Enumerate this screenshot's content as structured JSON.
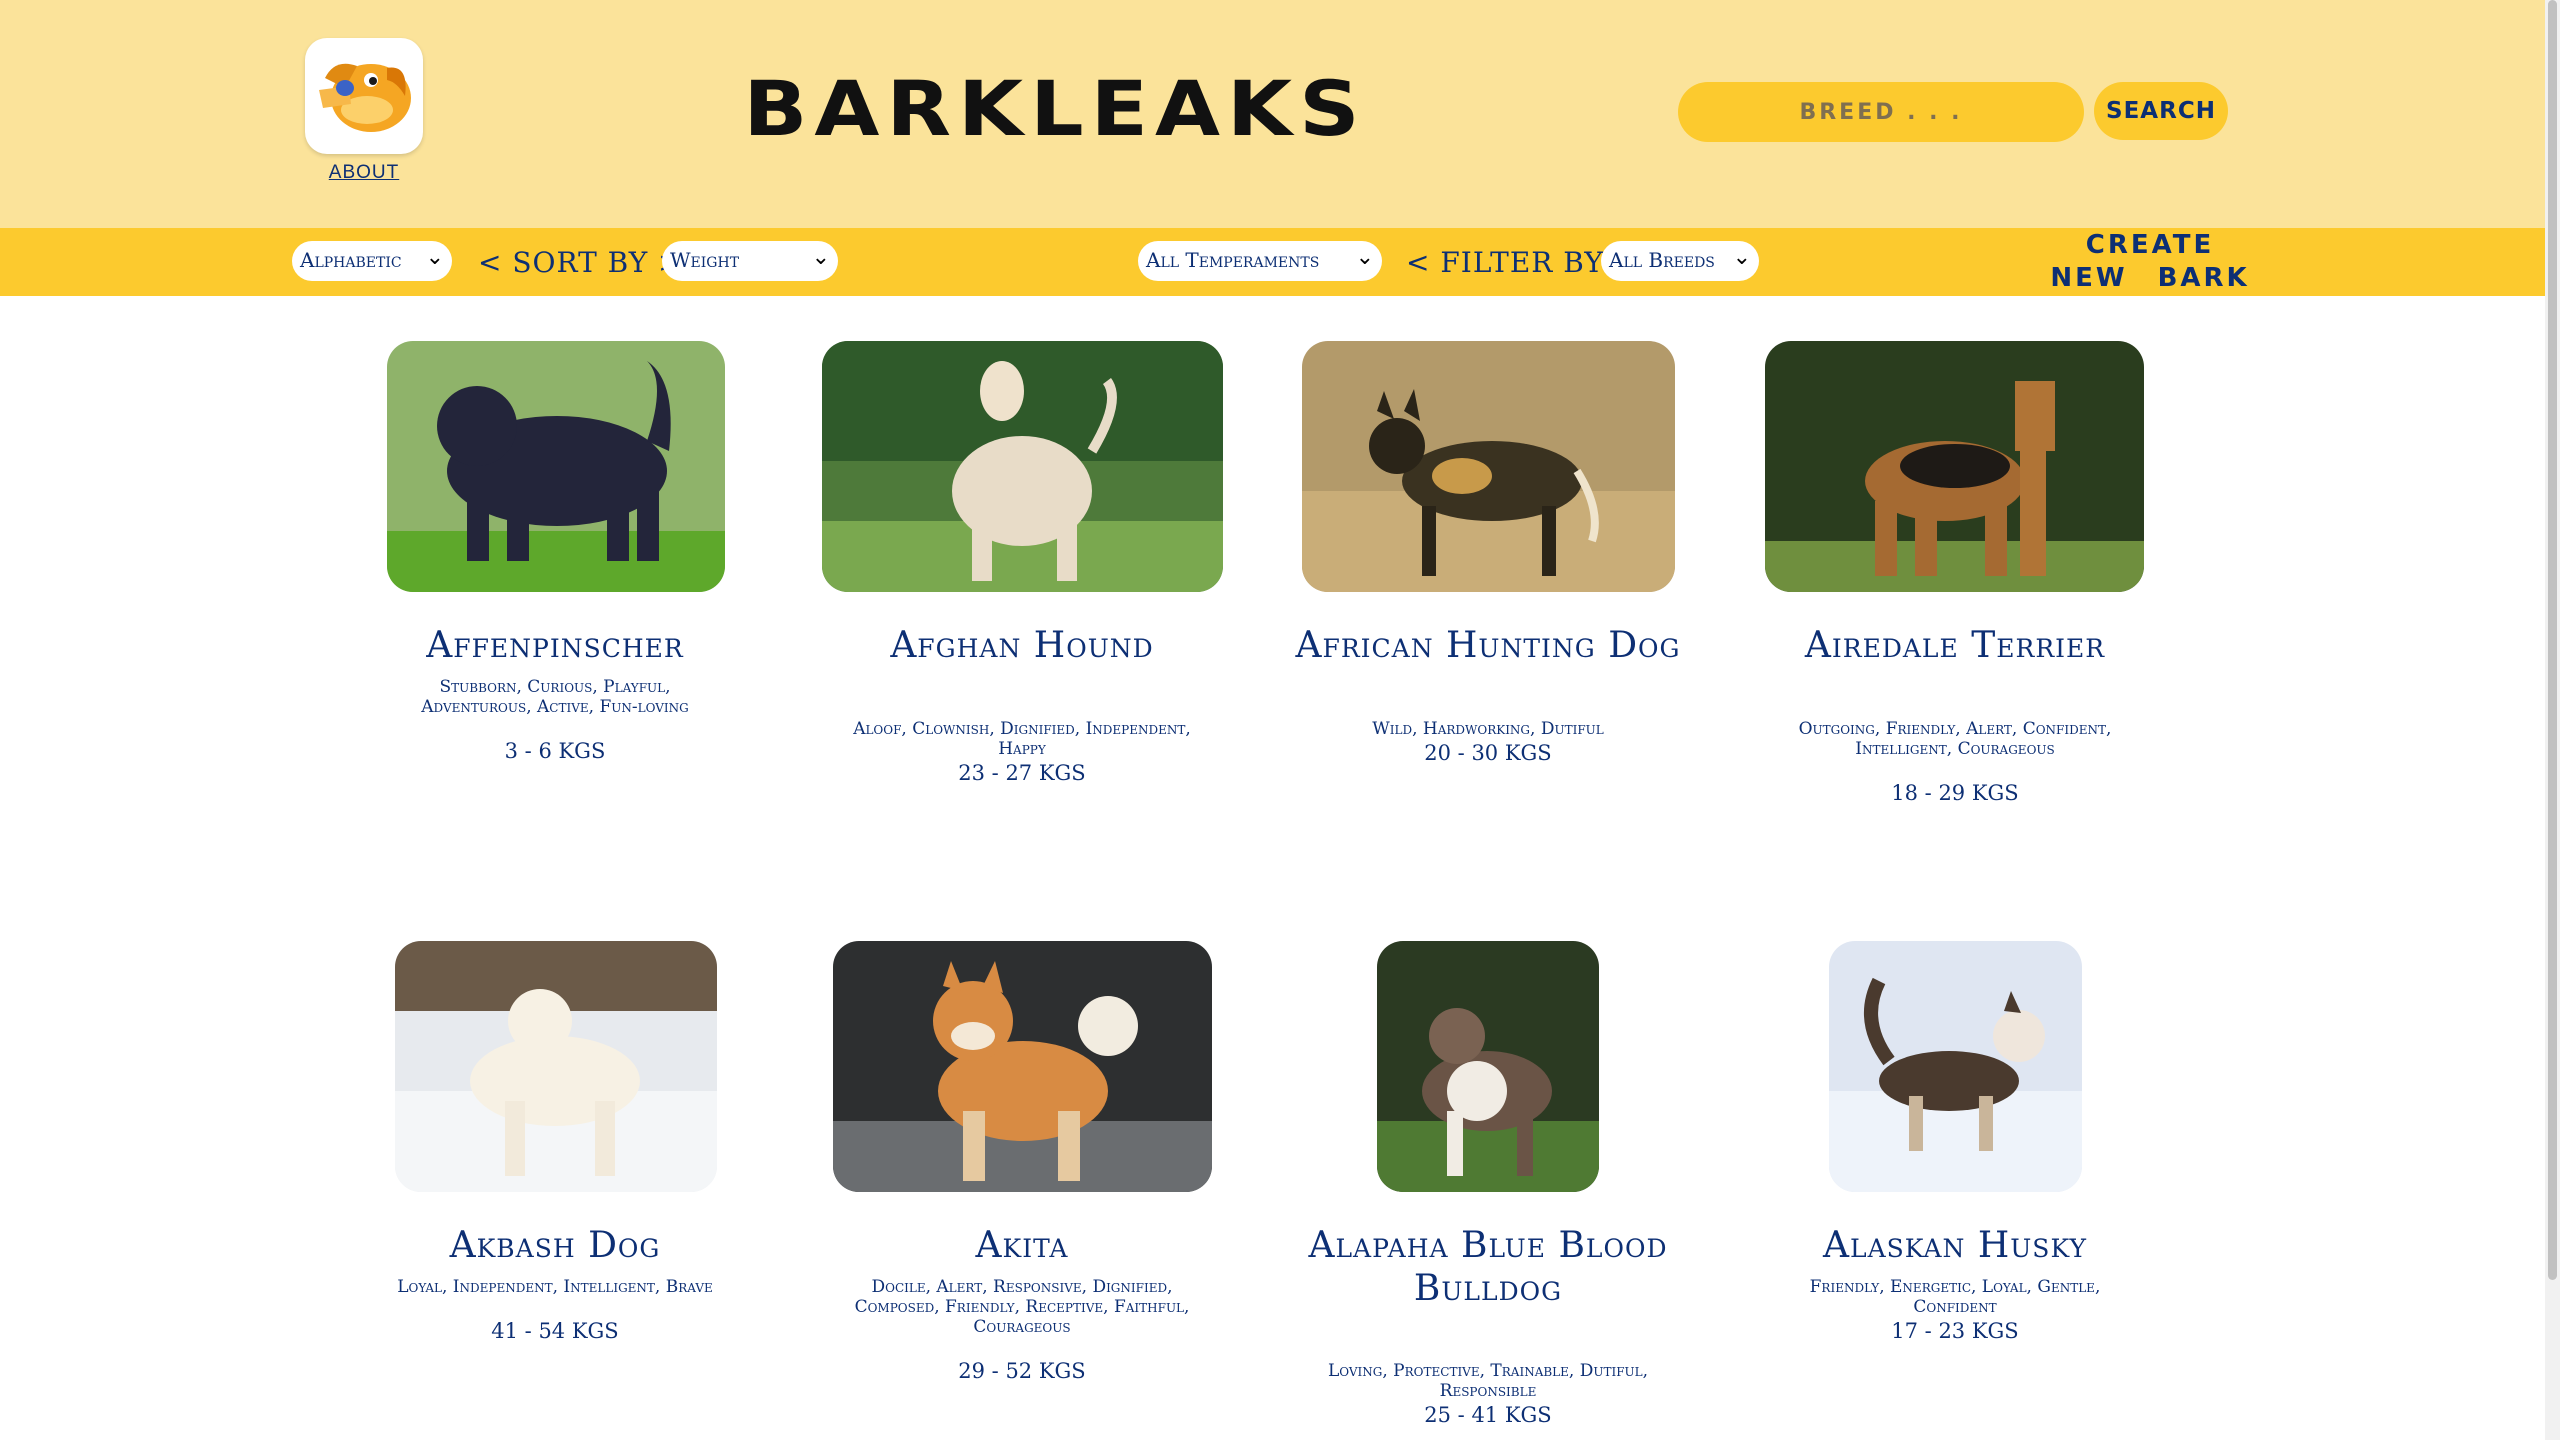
{
  "header": {
    "title": "BARKLEAKS",
    "about_label": "ABOUT",
    "search": {
      "placeholder": "BREED . . .",
      "button_label": "SEARCH"
    }
  },
  "toolbar": {
    "order_select": "Alphabetic",
    "sort_label": "< SORT BY >",
    "sort_select": "Weight",
    "temperament_select": "All Temperaments",
    "filter_label": "< FILTER BY >",
    "breed_select": "All Breeds",
    "create_line1": "CREATE",
    "create_line2": "NEW BARK"
  },
  "colors": {
    "header_bg": "#fbe39a",
    "accent_yellow": "#fcca2e",
    "text_navy": "#0d2f74"
  },
  "cards": [
    {
      "name": "Affenpinscher",
      "temperaments": "Stubborn, Curious, Playful, Adventurous, Active, Fun-loving",
      "weight": "3 - 6 KGS"
    },
    {
      "name": "Afghan Hound",
      "temperaments": "Aloof, Clownish, Dignified, Independent, Happy",
      "weight": "23 - 27 KGS"
    },
    {
      "name": "African Hunting Dog",
      "temperaments": "Wild, Hardworking, Dutiful",
      "weight": "20 - 30 KGS"
    },
    {
      "name": "Airedale Terrier",
      "temperaments": "Outgoing, Friendly, Alert, Confident, Intelligent, Courageous",
      "weight": "18 - 29 KGS"
    },
    {
      "name": "Akbash Dog",
      "temperaments": "Loyal, Independent, Intelligent, Brave",
      "weight": "41 - 54 KGS"
    },
    {
      "name": "Akita",
      "temperaments": "Docile, Alert, Responsive, Dignified, Composed, Friendly, Receptive, Faithful, Courageous",
      "weight": "29 - 52 KGS"
    },
    {
      "name": "Alapaha Blue Blood Bulldog",
      "temperaments": "Loving, Protective, Trainable, Dutiful, Responsible",
      "weight": "25 - 41 KGS"
    },
    {
      "name": "Alaskan Husky",
      "temperaments": "Friendly, Energetic, Loyal, Gentle, Confident",
      "weight": "17 - 23 KGS"
    }
  ]
}
